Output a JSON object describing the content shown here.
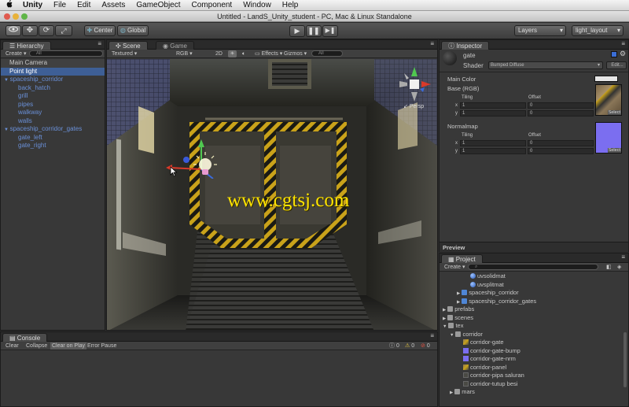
{
  "menubar": {
    "apple": "",
    "app": "Unity",
    "items": [
      "File",
      "Edit",
      "Assets",
      "GameObject",
      "Component",
      "Window",
      "Help"
    ]
  },
  "window": {
    "title": "Untitled - LandS_Unity_student - PC, Mac & Linux Standalone"
  },
  "toolbar": {
    "center": "Center",
    "global": "Global",
    "layers": "Layers",
    "layout": "light_layout"
  },
  "hierarchy": {
    "tab": "Hierarchy",
    "create": "Create",
    "search": "All",
    "items": [
      {
        "label": "Main Camera",
        "level": 0,
        "type": "object"
      },
      {
        "label": "Point light",
        "level": 0,
        "type": "selected"
      },
      {
        "label": "spaceship_corridor",
        "level": 0,
        "type": "prefab"
      },
      {
        "label": "back_hatch",
        "level": 1,
        "type": "prefab"
      },
      {
        "label": "grill",
        "level": 1,
        "type": "prefab"
      },
      {
        "label": "pipes",
        "level": 1,
        "type": "prefab"
      },
      {
        "label": "walkway",
        "level": 1,
        "type": "prefab"
      },
      {
        "label": "walls",
        "level": 1,
        "type": "prefab"
      },
      {
        "label": "spaceship_corridor_gates",
        "level": 0,
        "type": "prefab"
      },
      {
        "label": "gate_left",
        "level": 1,
        "type": "prefab"
      },
      {
        "label": "gate_right",
        "level": 1,
        "type": "prefab"
      }
    ]
  },
  "scene": {
    "tab_scene": "Scene",
    "tab_game": "Game",
    "shading": "Textured",
    "channel": "RGB",
    "mode2d": "2D",
    "effects": "Effects",
    "gizmos": "Gizmos",
    "search": "All",
    "persp": "Persp",
    "watermark": "www.cgtsj.com"
  },
  "console": {
    "tab": "Console",
    "buttons": [
      "Clear",
      "Collapse",
      "Clear on Play",
      "Error Pause"
    ],
    "counts": [
      "0",
      "0",
      "0"
    ]
  },
  "inspector": {
    "tab": "Inspector",
    "object": "gate",
    "shader_label": "Shader",
    "shader_value": "Bumped Diffuse",
    "edit": "Edit...",
    "main_color": "Main Color",
    "base": "Base (RGB)",
    "normalmap": "Normalmap",
    "tiling": "Tiling",
    "offset": "Offset",
    "x": "x",
    "y": "y",
    "base_vals": {
      "tx": "1",
      "ty": "1",
      "ox": "0",
      "oy": "0"
    },
    "nrm_vals": {
      "tx": "1",
      "ty": "1",
      "ox": "0",
      "oy": "0"
    },
    "select": "Select",
    "preview": "Preview",
    "colors": {
      "main": "#e6e6e6",
      "normal": "#7b6ef0"
    }
  },
  "project": {
    "tab": "Project",
    "create": "Create",
    "items": [
      {
        "label": "uvsolidmat",
        "level": 3,
        "icon": "material"
      },
      {
        "label": "uvsplitmat",
        "level": 3,
        "icon": "material"
      },
      {
        "label": "spaceship_corridor",
        "level": 2,
        "icon": "prefab",
        "arrow": "▶"
      },
      {
        "label": "spaceship_corridor_gates",
        "level": 2,
        "icon": "prefab",
        "arrow": "▶"
      },
      {
        "label": "prefabs",
        "level": 0,
        "icon": "folder",
        "arrow": "▶"
      },
      {
        "label": "scenes",
        "level": 0,
        "icon": "folder",
        "arrow": "▶"
      },
      {
        "label": "tex",
        "level": 0,
        "icon": "folder",
        "arrow": "▼"
      },
      {
        "label": "corridor",
        "level": 1,
        "icon": "folder",
        "arrow": "▼"
      },
      {
        "label": "corridor-gate",
        "level": 2,
        "icon": "texture"
      },
      {
        "label": "corridor-gate-bump",
        "level": 2,
        "icon": "normal"
      },
      {
        "label": "corridor-gate-nrm",
        "level": 2,
        "icon": "normal"
      },
      {
        "label": "corridor-panel",
        "level": 2,
        "icon": "texture"
      },
      {
        "label": "corridor-pipa saluran",
        "level": 2,
        "icon": "dark"
      },
      {
        "label": "corridor-tutup besi",
        "level": 2,
        "icon": "dark"
      },
      {
        "label": "mars",
        "level": 1,
        "icon": "folder",
        "arrow": "▶"
      }
    ]
  }
}
